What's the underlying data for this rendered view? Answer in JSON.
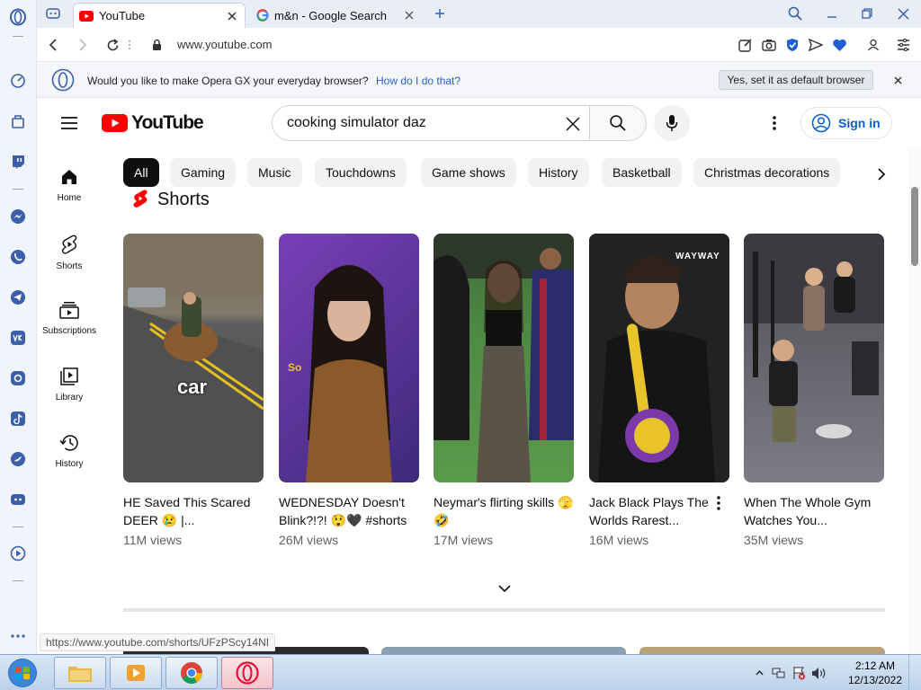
{
  "browser": {
    "tabs": [
      {
        "title": "YouTube",
        "favicon": "youtube-icon",
        "active": true
      },
      {
        "title": "m&n - Google Search",
        "favicon": "google-icon",
        "active": false
      }
    ],
    "url": "www.youtube.com",
    "infobar": {
      "message": "Would you like to make Opera GX your everyday browser?",
      "link": "How do I do that?",
      "button": "Yes, set it as default browser"
    },
    "status_url": "https://www.youtube.com/shorts/UFzPScy14NI",
    "sidebar_icons": [
      "opera-logo-icon",
      "speed-dial-icon",
      "bag-icon",
      "twitch-icon",
      "messenger-icon",
      "whatsapp-icon",
      "telegram-icon",
      "vk-icon",
      "instagram-icon",
      "tiktok-icon",
      "twitter-icon",
      "discord-icon",
      "player-icon",
      "more-icon"
    ]
  },
  "youtube": {
    "logo_text": "YouTube",
    "search_query": "cooking simulator daz",
    "sign_in": "Sign in",
    "guide": [
      {
        "label": "Home",
        "icon": "home-icon"
      },
      {
        "label": "Shorts",
        "icon": "shorts-icon"
      },
      {
        "label": "Subscriptions",
        "icon": "subscriptions-icon"
      },
      {
        "label": "Library",
        "icon": "library-icon"
      },
      {
        "label": "History",
        "icon": "history-icon"
      }
    ],
    "chips": [
      "All",
      "Gaming",
      "Music",
      "Touchdowns",
      "Game shows",
      "History",
      "Basketball",
      "Christmas decorations"
    ],
    "shorts_title": "Shorts",
    "shorts": [
      {
        "title": "HE Saved This Scared DEER 😢 |...",
        "views": "11M views",
        "overlay": "car"
      },
      {
        "title": "WEDNESDAY Doesn't Blink?!?! 😲🖤 #shorts",
        "views": "26M views",
        "overlay": "So"
      },
      {
        "title": "Neymar's flirting skills 🫣🤣",
        "views": "17M views",
        "overlay": ""
      },
      {
        "title": "Jack Black Plays The Worlds Rarest...",
        "views": "16M views",
        "overlay": "WAYWAY"
      },
      {
        "title": "When The Whole Gym Watches You...",
        "views": "35M views",
        "overlay": ""
      }
    ]
  },
  "taskbar": {
    "time": "2:12 AM",
    "date": "12/13/2022",
    "apps": [
      "explorer-icon",
      "media-player-icon",
      "chrome-icon",
      "opera-icon"
    ]
  }
}
